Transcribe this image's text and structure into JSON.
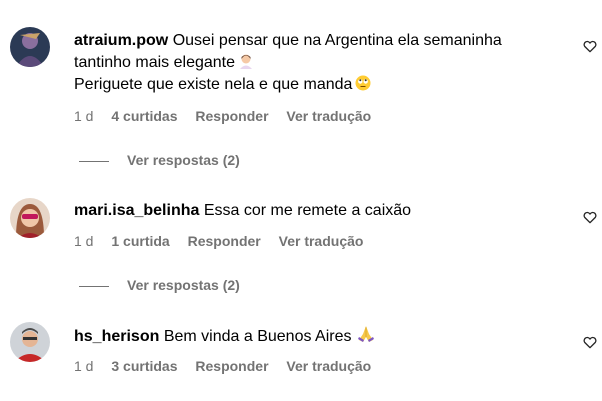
{
  "comments": [
    {
      "username": "atraium.pow",
      "lines": [
        "Ousei pensar que na Argentina ela semaninha",
        "tantinho mais elegante",
        "Periguete que existe nela e que manda"
      ],
      "time": "1 d",
      "likes": "4 curtidas",
      "reply_label": "Responder",
      "translate_label": "Ver tradução",
      "replies_label": "Ver respostas (2)"
    },
    {
      "username": "mari.isa_belinha",
      "lines": [
        "Essa cor me remete a caixão"
      ],
      "time": "1 d",
      "likes": "1 curtida",
      "reply_label": "Responder",
      "translate_label": "Ver tradução",
      "replies_label": "Ver respostas (2)"
    },
    {
      "username": "hs_herison",
      "lines": [
        "Bem vinda a Buenos Aires"
      ],
      "time": "1 d",
      "likes": "3 curtidas",
      "reply_label": "Responder",
      "translate_label": "Ver tradução"
    }
  ],
  "icons": {
    "like": "heart-icon",
    "emoji_1": "woman-tipping-hand-emoji",
    "emoji_2": "face-rolling-eyes-emoji",
    "emoji_3": "folded-hands-emoji"
  },
  "colors": {
    "meta": "#737373",
    "text": "#000000"
  }
}
